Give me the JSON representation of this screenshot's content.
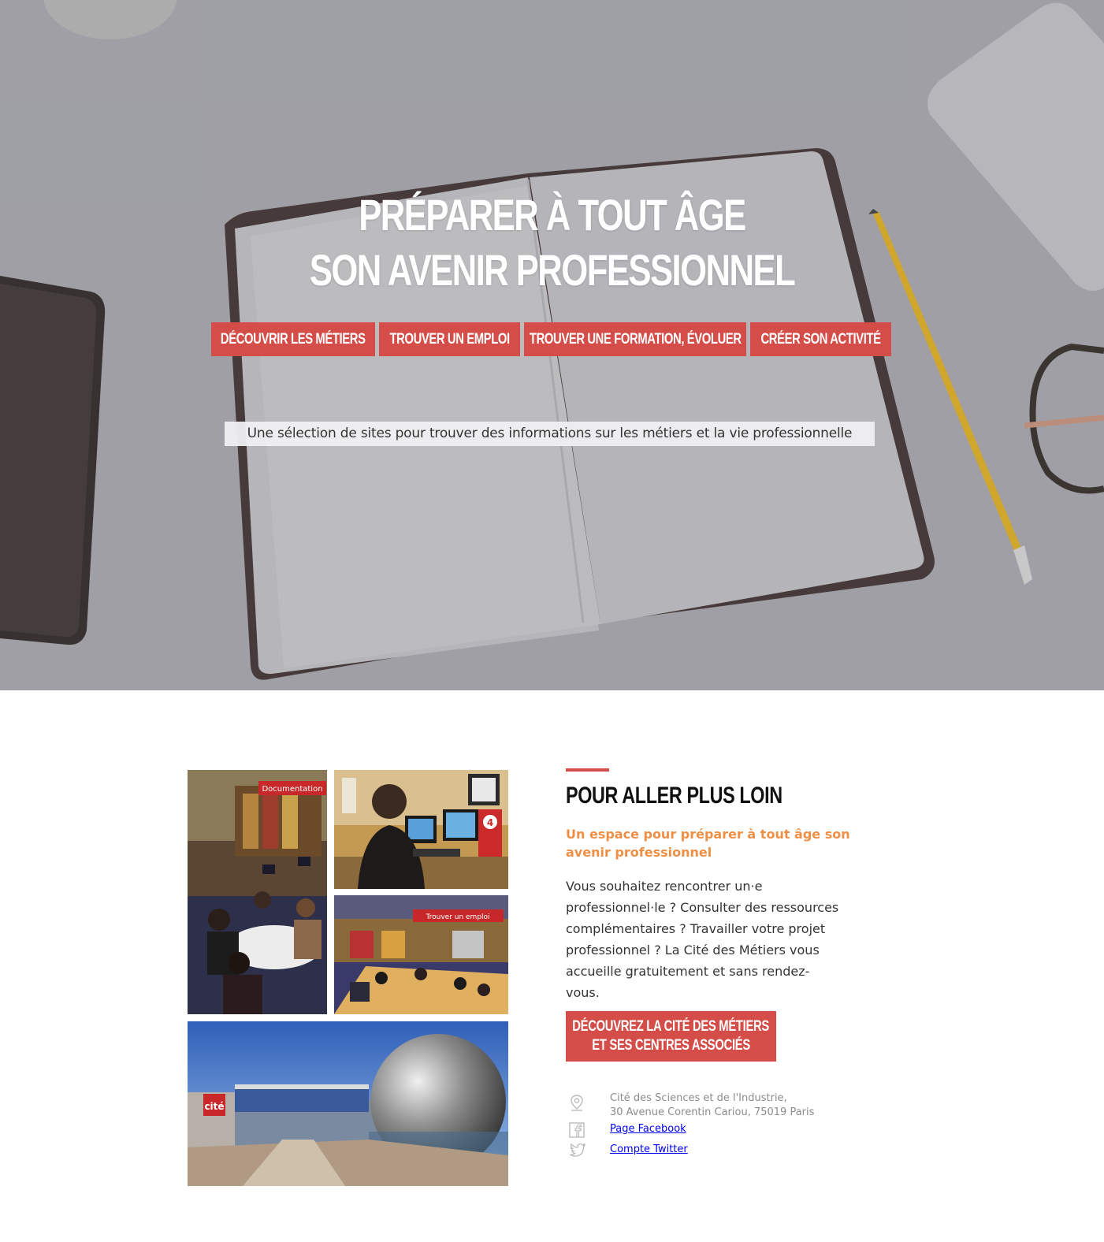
{
  "hero": {
    "title_line1": "Préparer à tout âge",
    "title_line2": "son avenir professionnel",
    "subtitle": "Une sélection de sites pour trouver des informations sur les métiers et la vie professionnelle"
  },
  "nav": [
    {
      "label": "Découvrir les métiers"
    },
    {
      "label": "Trouver un emploi"
    },
    {
      "label": "Trouver une formation, évoluer"
    },
    {
      "label": "Créer son activité"
    }
  ],
  "gallery": {
    "photo1_sign": "Documentation",
    "photo2_badge": "4",
    "photo3_sign": "Trouver un emploi",
    "photo4_sign": "cité"
  },
  "info": {
    "heading": "Pour aller plus loin",
    "tagline": "Un espace pour préparer à tout âge son avenir professionnel",
    "body": "Vous souhaitez rencontrer un·e professionnel·le ? Consulter des ressources complémentaires ? Travailler votre projet professionnel ? La Cité des Métiers vous accueille gratuitement et sans rendez-vous.",
    "cta_line1": "Découvrez la Cité des Métiers",
    "cta_line2": "et ses centres associés"
  },
  "contact": {
    "address_line1": "Cité des Sciences et de l'Industrie,",
    "address_line2": "30 Avenue Corentin Cariou, 75019 Paris",
    "facebook_label": "Page Facebook",
    "twitter_label": "Compte Twitter"
  },
  "icons": {
    "address": "map-pin-icon",
    "facebook": "facebook-icon",
    "twitter": "twitter-icon"
  },
  "colors": {
    "accent_red": "#d44d48",
    "tagline_orange": "#ef8f45",
    "contact_grey": "#8c8c8c"
  }
}
